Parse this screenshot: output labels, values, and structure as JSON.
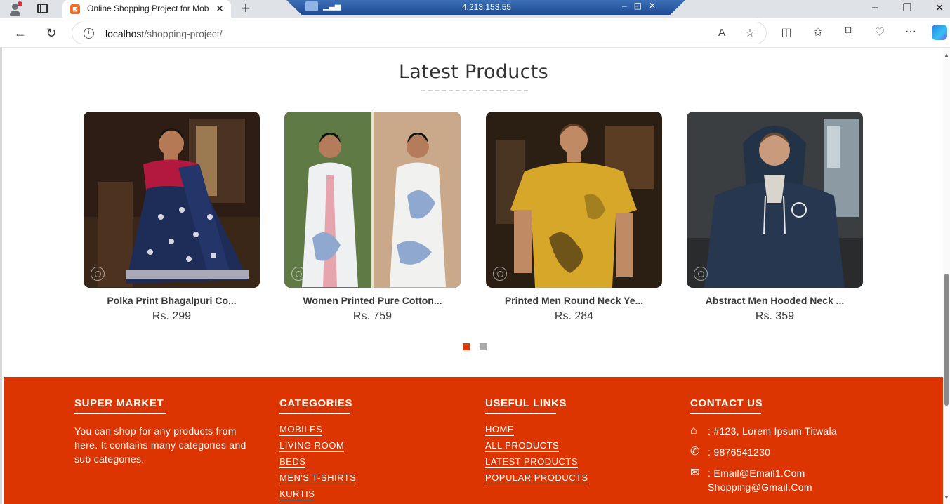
{
  "browser": {
    "tab_title": "Online Shopping Project for Mob",
    "url_host": "localhost",
    "url_path": "/shopping-project/",
    "remote_ip": "4.213.153.55"
  },
  "section": {
    "title": "Latest Products"
  },
  "products": [
    {
      "name": "Polka Print Bhagalpuri Co...",
      "price": "Rs. 299"
    },
    {
      "name": "Women Printed Pure Cotton...",
      "price": "Rs. 759"
    },
    {
      "name": "Printed Men Round Neck Ye...",
      "price": "Rs. 284"
    },
    {
      "name": "Abstract Men Hooded Neck ...",
      "price": "Rs. 359"
    }
  ],
  "carousel": {
    "pages": 2,
    "active_page": 1
  },
  "footer": {
    "about": {
      "title": "SUPER MARKET",
      "text": "You can shop for any products from here. It contains many categories and sub categories."
    },
    "categories": {
      "title": "CATEGORIES",
      "items": [
        "MOBILES",
        "LIVING ROOM",
        "BEDS",
        "MEN'S T-SHIRTS",
        "KURTIS"
      ]
    },
    "useful_links": {
      "title": "USEFUL LINKS",
      "items": [
        "HOME",
        "ALL PRODUCTS",
        "LATEST PRODUCTS",
        "POPULAR PRODUCTS"
      ]
    },
    "contact": {
      "title": "CONTACT US",
      "address": ": #123, Lorem Ipsum Titwala",
      "phone": ": 9876541230",
      "email_line1": ": Email@Email1.Com",
      "email_line2": "Shopping@Gmail.Com"
    }
  },
  "colors": {
    "accent": "#dd3501",
    "dot_inactive": "#aaaaaa"
  }
}
